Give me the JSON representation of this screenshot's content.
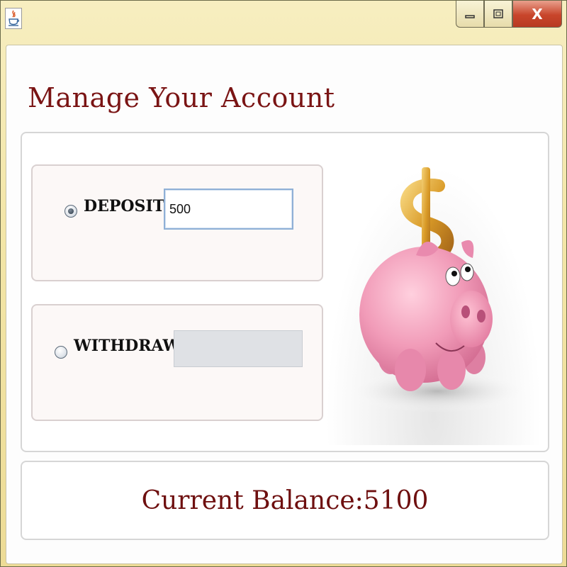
{
  "window": {
    "app_icon": "java-icon",
    "controls": {
      "minimize_icon": "minimize-icon",
      "maximize_icon": "maximize-icon",
      "close_label": "X"
    }
  },
  "page": {
    "title": "Manage Your Account"
  },
  "deposit": {
    "label": "DEPOSIT",
    "selected": true,
    "value": "500"
  },
  "withdraw": {
    "label": "WITHDRAW",
    "selected": false,
    "value": ""
  },
  "illustration": {
    "icon": "piggy-bank-with-dollar-icon"
  },
  "balance": {
    "text": "Current Balance:5100"
  },
  "colors": {
    "title": "#7a1414",
    "balance": "#6e0f0f",
    "titlebar": "#f3e6a8",
    "close_button": "#c8452b",
    "pig": "#f29ab6",
    "dollar": "#d89b2c"
  }
}
